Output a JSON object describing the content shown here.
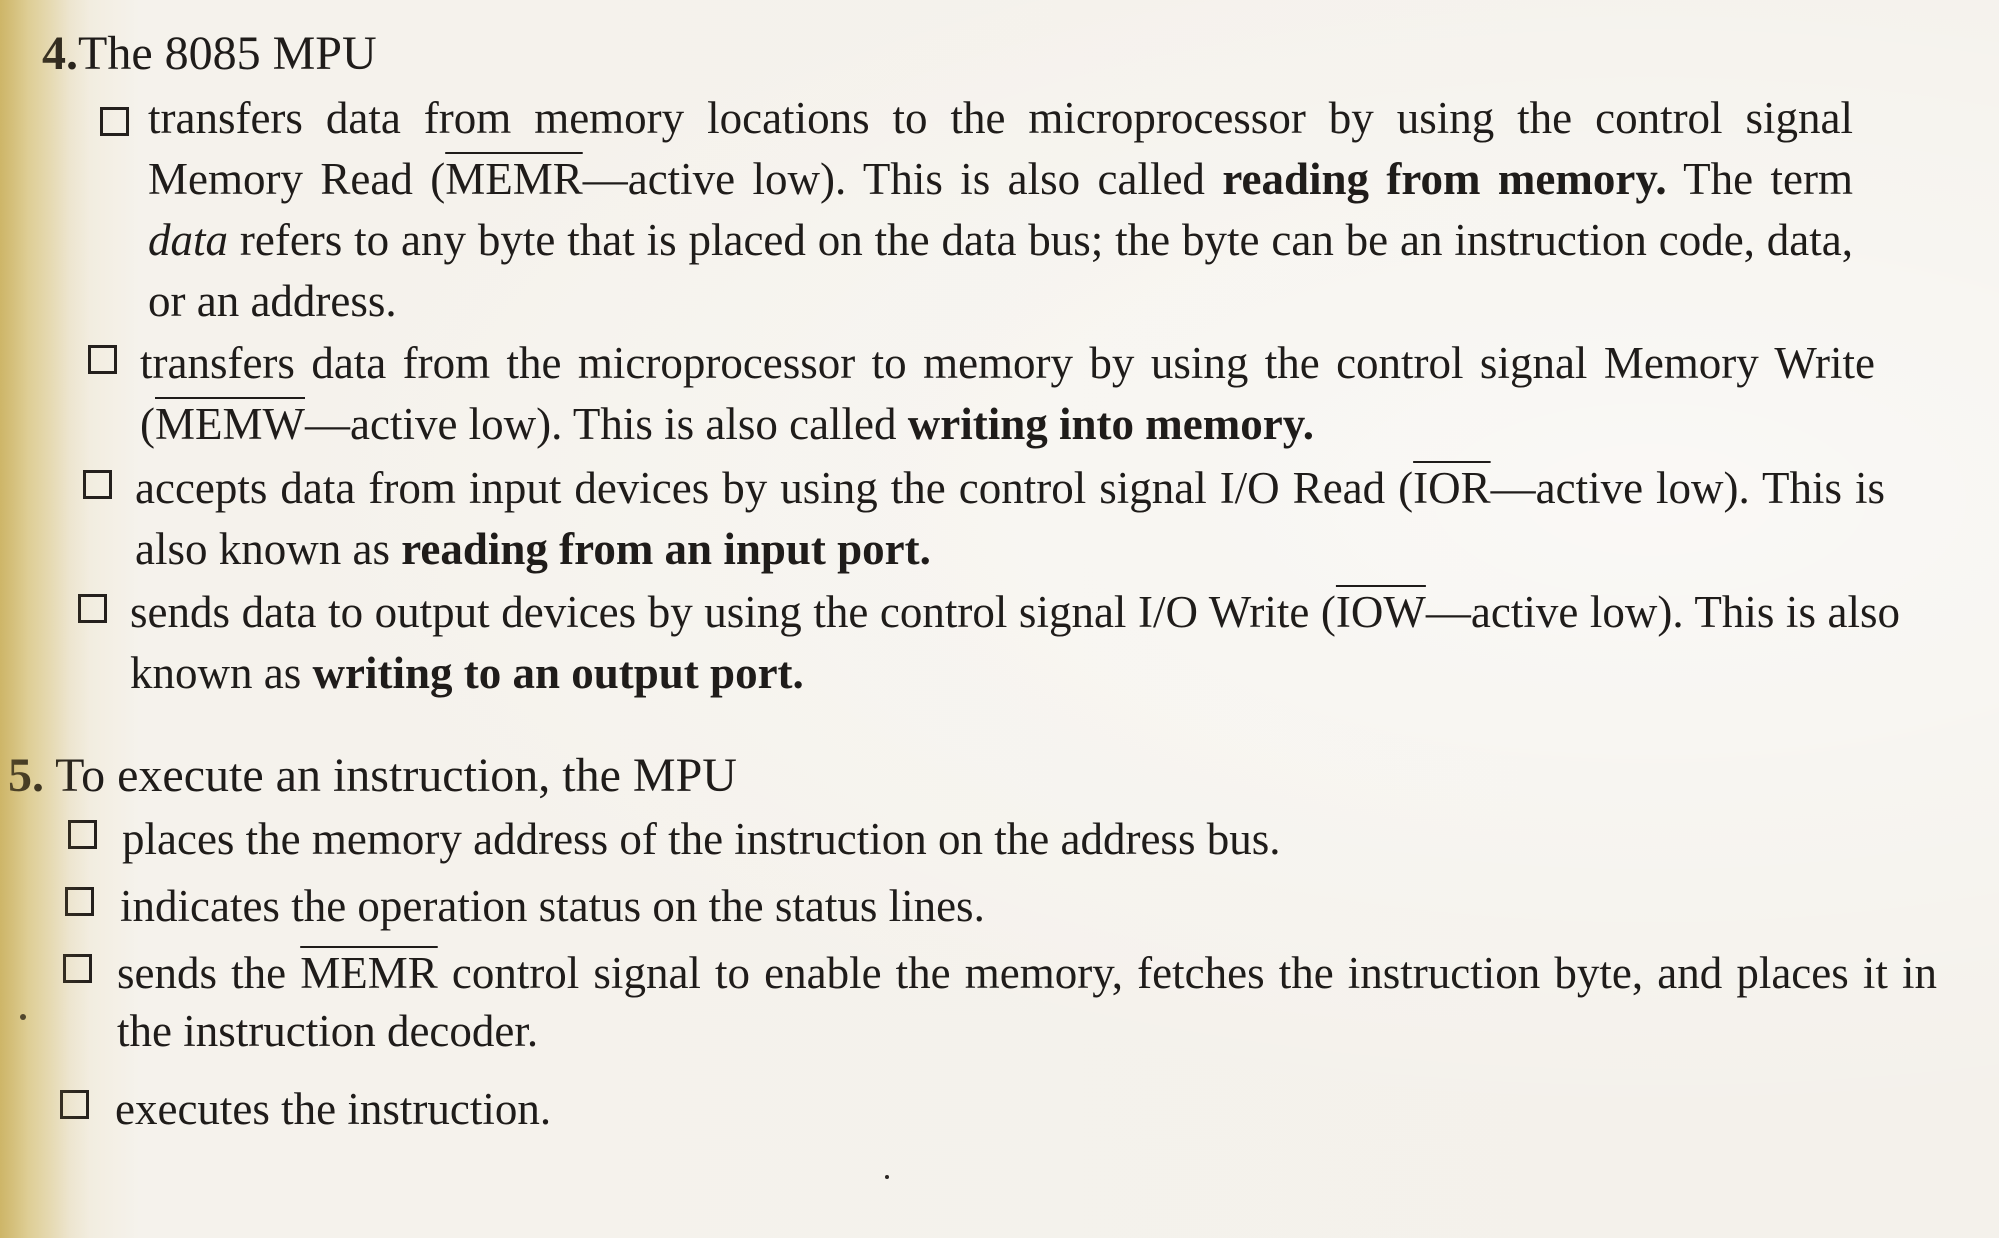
{
  "q4": {
    "number": "4.",
    "title": "The 8085 MPU",
    "items": [
      {
        "t1": "transfers data from memory locations to the microprocessor by using the control signal Memory Read (",
        "sig": "MEMR",
        "t2": "—active low). This is also called ",
        "b1": "reading from memory.",
        "t3": " The term ",
        "em": "data",
        "t4": " refers to any byte that is placed on the data bus; the byte can be an instruction code, data, or an address."
      },
      {
        "t1": "transfers data from the microprocessor to memory by using the control signal Memory Write (",
        "sig": "MEMW",
        "t2": "—active low). This is also called ",
        "b1": "writing into memory."
      },
      {
        "t1": "accepts data from input devices by using the control signal I/O Read (",
        "sig": "IOR",
        "t2": "—active low). This is also known as ",
        "b1": "reading from an input port."
      },
      {
        "t1": "sends data to output devices by using the control signal I/O Write (",
        "sig": "IOW",
        "t2": "—active low). This is also known as ",
        "b1": "writing to an output port."
      }
    ]
  },
  "q5": {
    "number": "5.",
    "title": "To execute an instruction, the MPU",
    "items": [
      {
        "text": "places the memory address of the instruction on the address bus."
      },
      {
        "text": "indicates the operation status on the status lines."
      },
      {
        "t1": "sends the ",
        "sig": "MEMR",
        "t2": " control signal to enable the memory, fetches the instruction byte, and places it in the instruction decoder."
      },
      {
        "text": "executes the instruction."
      }
    ]
  }
}
